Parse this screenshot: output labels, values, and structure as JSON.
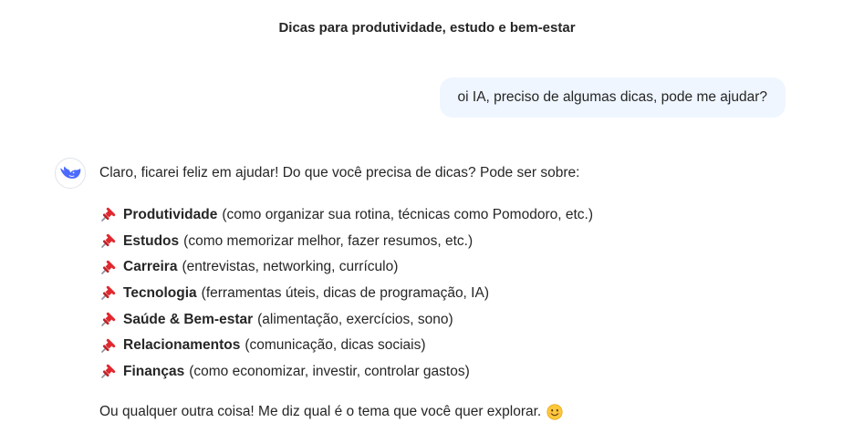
{
  "chat": {
    "title": "Dicas para produtividade, estudo e bem-estar"
  },
  "user_message": {
    "text": "oi IA, preciso de algumas dicas, pode me ajudar?"
  },
  "assistant": {
    "avatar_icon": "whale-logo-icon",
    "accent_color": "#4d6bfe",
    "intro": "Claro, ficarei feliz em ajudar! Do que você precisa de dicas? Pode ser sobre:",
    "topics": [
      {
        "icon": "pushpin-icon",
        "name": "Produtividade",
        "detail": "(como organizar sua rotina, técnicas como Pomodoro, etc.)"
      },
      {
        "icon": "pushpin-icon",
        "name": "Estudos",
        "detail": "(como memorizar melhor, fazer resumos, etc.)"
      },
      {
        "icon": "pushpin-icon",
        "name": "Carreira",
        "detail": "(entrevistas, networking, currículo)"
      },
      {
        "icon": "pushpin-icon",
        "name": "Tecnologia",
        "detail": "(ferramentas úteis, dicas de programação, IA)"
      },
      {
        "icon": "pushpin-icon",
        "name": "Saúde & Bem-estar",
        "detail": "(alimentação, exercícios, sono)"
      },
      {
        "icon": "pushpin-icon",
        "name": "Relacionamentos",
        "detail": "(comunicação, dicas sociais)"
      },
      {
        "icon": "pushpin-icon",
        "name": "Finanças",
        "detail": "(como economizar, investir, controlar gastos)"
      }
    ],
    "outro": "Ou qualquer outra coisa! Me diz qual é o tema que você quer explorar.",
    "outro_icon": "smiling-face-icon"
  },
  "colors": {
    "user_bubble_bg": "#eff6ff",
    "text": "#262626"
  }
}
